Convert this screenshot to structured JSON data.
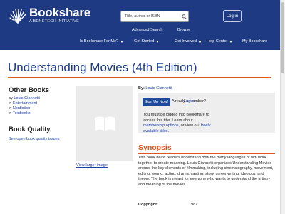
{
  "header": {
    "logo_name": "Bookshare",
    "logo_sub": "A BENETECH INITIATIVE",
    "search_placeholder": "Title, author or ISBN",
    "login_label": "Log in",
    "subnav": [
      "Advanced Search",
      "Browse"
    ],
    "mainnav": [
      {
        "label": "Is Bookshare For Me?",
        "dropdown": true
      },
      {
        "label": "Get Started",
        "dropdown": true
      },
      {
        "label": "Get Involved",
        "dropdown": true
      },
      {
        "label": "Help Center",
        "dropdown": true
      },
      {
        "label": "My Bookshare",
        "dropdown": false
      }
    ]
  },
  "book": {
    "title": "Understanding Movies (4th Edition)",
    "by_label": "By:",
    "author": "Louis Giannetti",
    "view_large": "View larger image"
  },
  "sidebar": {
    "other_books_heading": "Other Books",
    "other_books": [
      {
        "prefix": "by ",
        "link": "Louis Giannetti"
      },
      {
        "prefix": "in ",
        "link": "Entertainment"
      },
      {
        "prefix": "in ",
        "link": "Nonfiction"
      },
      {
        "prefix": "in ",
        "link": "Textbooks"
      }
    ],
    "quality_heading": "Book Quality",
    "quality_link": "See open book quality issues"
  },
  "signup": {
    "button": "Sign Up Now!",
    "already": "Already a Member?",
    "login_link": "Log in",
    "must_text_1": "You must be logged into Bookshare to access this title. Learn about ",
    "membership_link": "membership options",
    "must_text_2": ", or view our ",
    "freely_link": "freely available titles",
    "must_text_3": "."
  },
  "synopsis": {
    "heading": "Synopsis",
    "body": "This book helps readers understand how the many languages of film work together to create meaning. Louis Giannetti organizes Understanding Movies around the key elements of filmmaking, including cinematography, movement, editing, sound, acting, drama, casting, story, screenwriting, ideology, and theory. The book is meant for everyone who wants to understand the artistry and meaning of the movies."
  },
  "copyright": {
    "label": "Copyright:",
    "value": "1987"
  },
  "colors": {
    "header_bg": "#1d3a82",
    "title": "#1a3a8e",
    "accent": "#e0561f",
    "link": "#1a3fa6",
    "signup_button": "#1e4a9a"
  }
}
